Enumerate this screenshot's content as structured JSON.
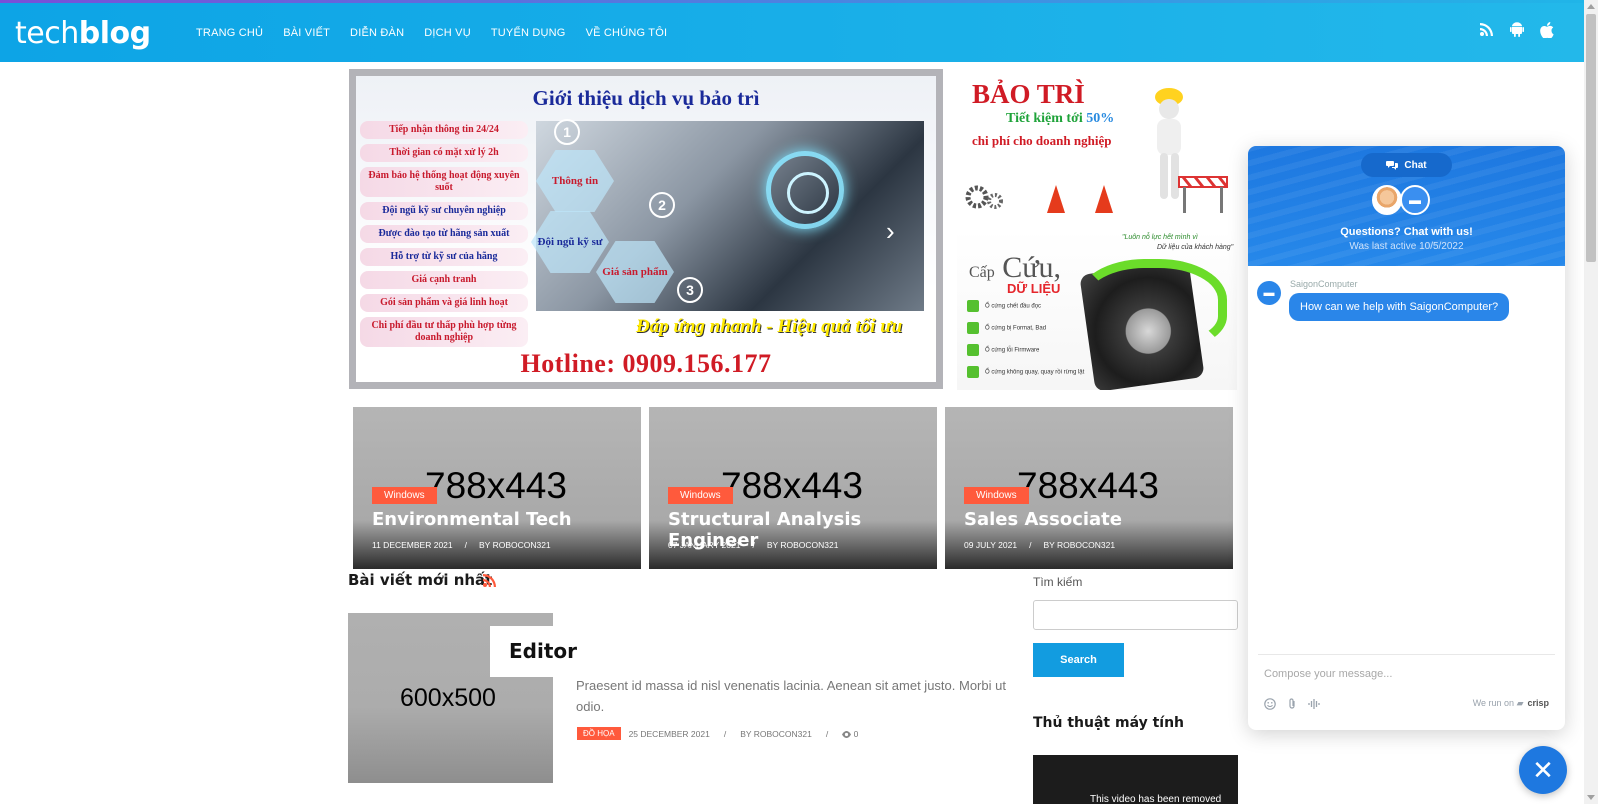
{
  "header": {
    "logo_light": "tech",
    "logo_bold": "blog",
    "nav": [
      "TRANG CHỦ",
      "BÀI VIẾT",
      "DIỄN ĐÀN",
      "DỊCH VỤ",
      "TUYỂN DỤNG",
      "VỀ CHÚNG TÔI"
    ],
    "icons": [
      "rss-icon",
      "android-icon",
      "apple-icon"
    ],
    "colors": {
      "bar": "#0da4e6",
      "accent": "#ff5a3c"
    }
  },
  "banner_main": {
    "title": "Giới thiệu dịch vụ bảo trì",
    "list": [
      "Tiếp nhận thông tin 24/24",
      "Thời gian có mặt xử lý 2h",
      "Đảm bảo hệ thống hoạt động xuyên suốt",
      "Đội ngũ kỹ sư chuyên nghiệp",
      "Được đào tạo từ hãng sản xuất",
      "Hỗ trợ từ kỹ sư của hãng",
      "Giá cạnh tranh",
      "Gói sản phẩm và giá linh hoạt",
      "Chi phí đầu tư thấp phù hợp từng doanh nghiệp"
    ],
    "hex_1": "Thông tin",
    "hex_2": "Đội ngũ kỹ sư",
    "hex_3": "Giá sản phẩm",
    "num_1": "1",
    "num_2": "2",
    "num_3": "3",
    "slogan": "Đáp ứng nhanh - Hiệu quả tối ưu",
    "hotline": "Hotline: 0909.156.177"
  },
  "banner_side_1": {
    "title": "BẢO TRÌ",
    "line2_prefix": "Tiết kiệm tới",
    "line2_value": "50%",
    "line3": "chi phí cho doanh nghiệp"
  },
  "banner_side_2": {
    "title_small": "Cấp",
    "title_big": "Cứu,",
    "subtitle": "DỮ LIỆU",
    "quote_1": "\"Luôn nỗ lực hết mình vì",
    "quote_2": "Dữ liệu của khách hàng\"",
    "checks": [
      "Ổ cứng chết đầu đọc",
      "Ổ cứng bị Format, Bad",
      "Ổ cứng lỗi Firmware",
      "Ổ cứng không quay, quay rồi rừng lật"
    ]
  },
  "featured": [
    {
      "placeholder": "788x443",
      "category": "Windows",
      "title": "Environmental Tech",
      "date": "11 DECEMBER 2021",
      "author": "BY ROBOCON321"
    },
    {
      "placeholder": "788x443",
      "category": "Windows",
      "title": "Structural Analysis Engineer",
      "date": "07 JANUARY 2021",
      "author": "BY ROBOCON321"
    },
    {
      "placeholder": "788x443",
      "category": "Windows",
      "title": "Sales Associate",
      "date": "09 JULY 2021",
      "author": "BY ROBOCON321"
    }
  ],
  "meta_separator": "/",
  "latest": {
    "heading": "Bài viết mới nhất",
    "post": {
      "placeholder": "600x500",
      "title": "Editor",
      "excerpt": "Praesent id massa id nisl venenatis lacinia. Aenean sit amet justo. Morbi ut odio.",
      "category": "ĐỒ HỌA",
      "date": "25 DECEMBER 2021",
      "author": "BY ROBOCON321",
      "views": "0"
    }
  },
  "sidebar": {
    "search_label": "Tìm kiếm",
    "search_placeholder": "",
    "search_button": "Search",
    "tips_heading": "Thủ thuật máy tính",
    "video_text": "This video has been removed"
  },
  "chat": {
    "tab": "Chat",
    "question": "Questions? Chat with us!",
    "last_active": "Was last active 10/5/2022",
    "operator": "SaigonComputer",
    "message": "How can we help with SaigonComputer?",
    "compose_placeholder": "Compose your message...",
    "brand_prefix": "We run on",
    "brand": "crisp",
    "close": "✕",
    "color": "#1e78e0"
  }
}
